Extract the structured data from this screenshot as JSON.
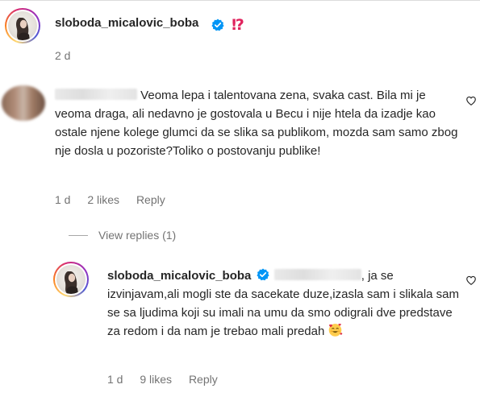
{
  "post": {
    "username": "sloboda_micalovic_boba",
    "caption_emoji": "⁉️",
    "time": "2 d"
  },
  "comment": {
    "author_hidden": true,
    "text_line1": "Veoma lepa i talentovana zena, svaka cast. Bila mi",
    "text_rest": "je veoma draga, ali nedavno je gostovala u Becu i nije htela da izadje kao ostale njene kolege glumci da se slika sa publikom, mozda sam samo zbog nje dosla u pozoriste?Toliko o postovanju publike!",
    "time": "1 d",
    "likes": "2 likes",
    "reply_label": "Reply"
  },
  "view_replies_label": "View replies (1)",
  "reply": {
    "username": "sloboda_micalovic_boba",
    "text_line1_suffix": ", ja se",
    "text_rest": "izvinjavam,ali mogli ste da sacekate duze,izasla sam i slikala sam se sa ljudima koji su imali na umu da smo odigrali dve predstave za redom i da nam je trebao mali predah",
    "emoji": "smiling-face-with-hearts",
    "time": "1 d",
    "likes": "9 likes",
    "reply_label": "Reply"
  },
  "colors": {
    "text": "#262626",
    "secondary": "#737373",
    "verified": "#0095f6",
    "interrobang": "#e0245e"
  }
}
